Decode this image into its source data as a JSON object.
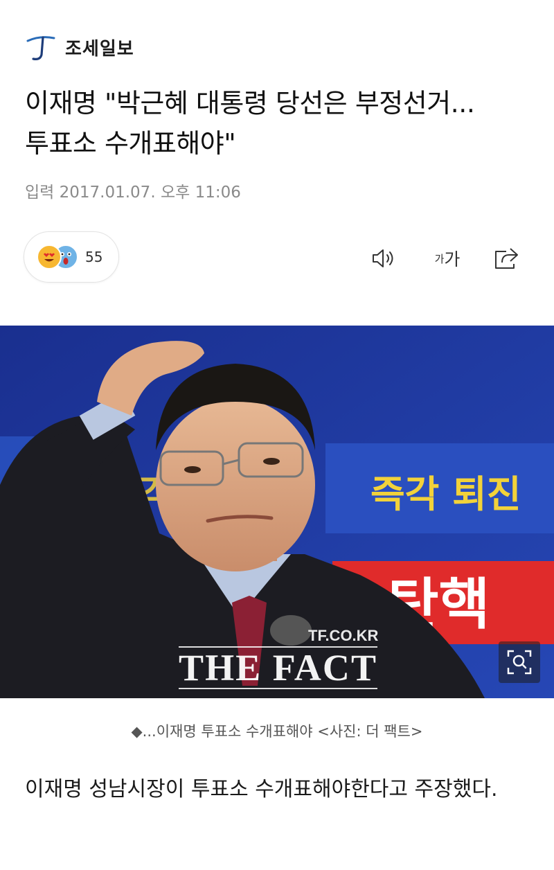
{
  "publisher": {
    "logo_icon": "chosun-logo-icon",
    "name": "조세일보"
  },
  "article": {
    "headline_line1": "이재명 \"박근혜 대통령 당선은 부정선거...",
    "headline_line2": "투표소 수개표해야\"",
    "dateline": "입력 2017.01.07. 오후 11:06"
  },
  "reactions": {
    "icons": [
      "heart-eyes-emoji-icon",
      "surprised-emoji-icon"
    ],
    "count": "55"
  },
  "toolbar": {
    "speaker_icon": "speaker-icon",
    "font_small": "가",
    "font_large": "가",
    "share_icon": "share-icon"
  },
  "photo": {
    "watermark_site": "TF.CO.KR",
    "watermark_brand": "THE FACT",
    "banner_text_1": "즉각 퇴진",
    "banner_text_2": "탄핵",
    "banner_text_left": "즉각",
    "zoom_icon": "zoom-icon",
    "colors": {
      "background": "#1f3aa0",
      "banner_red": "#e02b2b",
      "banner_yellow": "#f2d23a"
    }
  },
  "caption": "◆...이재명 투표소 수개표해야 <사진: 더 팩트>",
  "body": {
    "text": "이재명 성남시장이 투표소 수개표해야한다고 주장했다."
  }
}
